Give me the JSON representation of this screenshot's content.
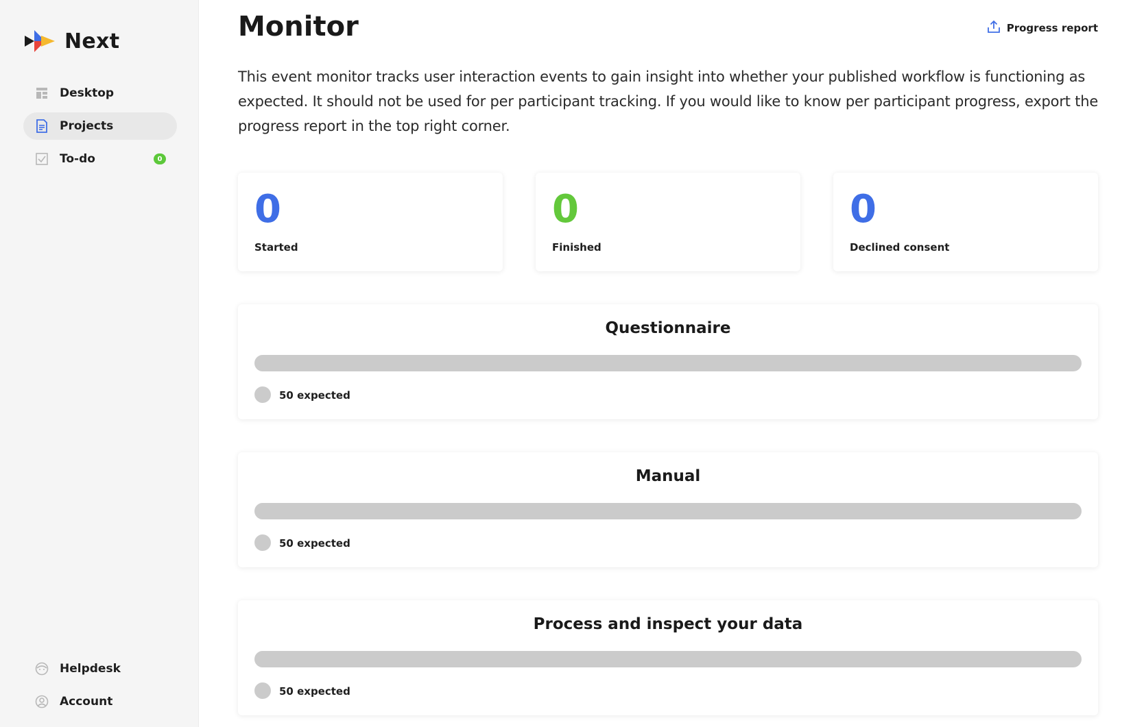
{
  "app": {
    "name": "Next"
  },
  "sidebar": {
    "items": [
      {
        "label": "Desktop",
        "icon": "dashboard-icon"
      },
      {
        "label": "Projects",
        "icon": "document-icon",
        "active": true
      },
      {
        "label": "To-do",
        "icon": "checkbox-icon",
        "badge": "0"
      }
    ],
    "bottom_items": [
      {
        "label": "Helpdesk",
        "icon": "helpdesk-icon"
      },
      {
        "label": "Account",
        "icon": "account-icon"
      }
    ]
  },
  "main": {
    "title": "Monitor",
    "progress_report_label": "Progress report",
    "description": "This event monitor tracks user interaction events to gain insight into whether your published workflow is functioning as expected. It should not be used for per participant tracking. If you would like to know per participant progress, export the progress report in the top right corner.",
    "stats": [
      {
        "value": "0",
        "label": "Started",
        "color": "#3f6ee6"
      },
      {
        "value": "0",
        "label": "Finished",
        "color": "#63c83b"
      },
      {
        "value": "0",
        "label": "Declined consent",
        "color": "#3f6ee6"
      }
    ],
    "sections": [
      {
        "title": "Questionnaire",
        "legend": "50 expected",
        "progress": 0
      },
      {
        "title": "Manual",
        "legend": "50 expected",
        "progress": 0
      },
      {
        "title": "Process and inspect your data",
        "legend": "50 expected",
        "progress": 0
      }
    ]
  },
  "colors": {
    "accent_blue": "#3f6ee6",
    "accent_green": "#63c83b",
    "bar_empty": "#cbcbcb",
    "sidebar_bg": "#f5f5f5"
  }
}
